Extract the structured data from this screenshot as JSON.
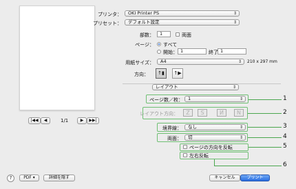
{
  "printer": {
    "label": "プリンタ：",
    "value": "OKI Printer PS"
  },
  "preset": {
    "label": "プリセット：",
    "value": "デフォルト設定"
  },
  "copies": {
    "label": "部数：",
    "value": "1",
    "duplex_label": "両面"
  },
  "pages": {
    "label": "ページ：",
    "all_label": "すべて",
    "from_label": "開始：",
    "from_value": "1",
    "to_label": "終了：",
    "to_value": "1"
  },
  "paper": {
    "label": "用紙サイズ：",
    "value": "A4",
    "dims": "210 x 297 mm"
  },
  "orientation": {
    "label": "方向："
  },
  "section": {
    "value": "レイアウト"
  },
  "layout": {
    "pages_per_sheet_label": "ページ数／枚：",
    "pages_per_sheet_value": "1",
    "direction_label": "レイアウト方向：",
    "direction_glyphs": [
      "Z",
      "S",
      "И",
      "N"
    ],
    "border_label": "境界線：",
    "border_value": "なし",
    "two_sided_label": "両面：",
    "two_sided_value": "切",
    "reverse_label": "ページの方向を反転",
    "flip_label": "左右反転"
  },
  "preview": {
    "page_indicator": "1/1",
    "first": "|◀◀",
    "prev": "◀",
    "next": "▶",
    "last": "▶▶|"
  },
  "footer": {
    "help": "?",
    "pdf_label": "PDF ▾",
    "hide_details_label": "詳細を隠す",
    "cancel_label": "キャンセル",
    "print_label": "プリント"
  },
  "callouts": [
    "1",
    "2",
    "3",
    "4",
    "5",
    "6"
  ],
  "colors": {
    "accent": "#2a6de0",
    "callout_green": "#4aa64e"
  }
}
